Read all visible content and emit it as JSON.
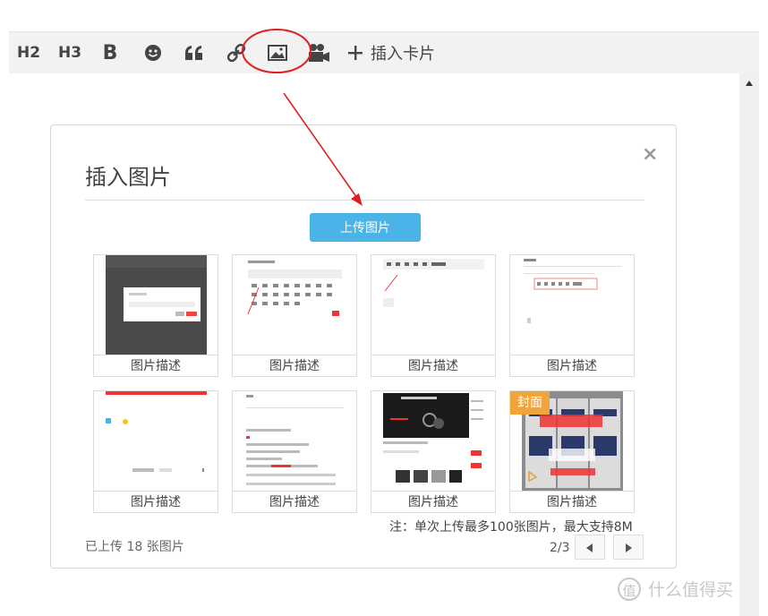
{
  "toolbar": {
    "h2_label": "H2",
    "h3_label": "H3",
    "bold_label": "B",
    "insert_card_label": "插入卡片",
    "icons": [
      "emoji-icon",
      "quote-icon",
      "link-icon",
      "image-icon",
      "video-icon",
      "plus-icon"
    ]
  },
  "modal": {
    "title": "插入图片",
    "close_label": "×",
    "upload_label": "上传图片",
    "images": [
      {
        "caption": "图片描述"
      },
      {
        "caption": "图片描述"
      },
      {
        "caption": "图片描述"
      },
      {
        "caption": "图片描述"
      },
      {
        "caption": "图片描述"
      },
      {
        "caption": "图片描述"
      },
      {
        "caption": "图片描述"
      },
      {
        "caption": "图片描述",
        "cover_tag": "封面"
      }
    ],
    "note": "注：单次上传最多100张图片，最大支持8M",
    "uploaded_count": "已上传 18 张图片",
    "pager": "2/3"
  },
  "watermark": {
    "logo_glyph": "值",
    "text": "什么值得买"
  },
  "colors": {
    "accent": "#4ab3e8",
    "annotation": "#e02020",
    "cover_tag": "#f0a53a"
  }
}
